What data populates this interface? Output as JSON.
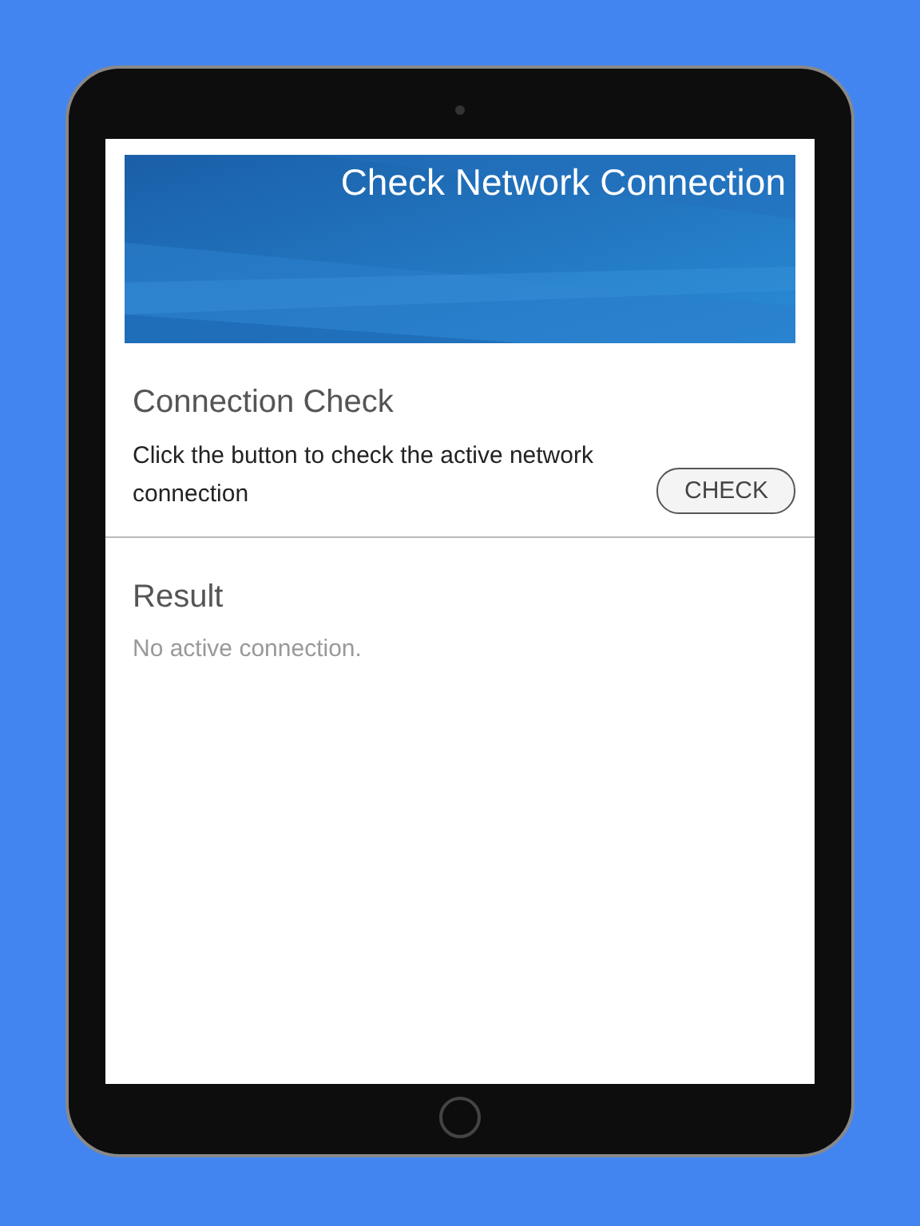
{
  "header": {
    "title": "Check Network Connection"
  },
  "connection_check": {
    "heading": "Connection Check",
    "description": "Click the button to check the active network connection",
    "button": "CHECK"
  },
  "result": {
    "heading": "Result",
    "message": "No active connection."
  }
}
